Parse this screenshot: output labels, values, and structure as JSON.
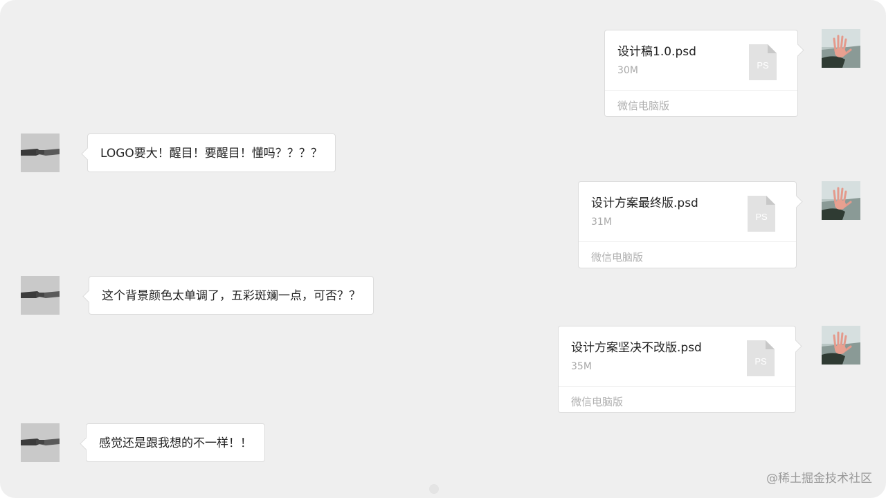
{
  "messages": [
    {
      "type": "file",
      "side": "right",
      "file_name": "设计稿1.0.psd",
      "file_size": "30M",
      "file_icon_label": "PS",
      "source": "微信电脑版"
    },
    {
      "type": "text",
      "side": "left",
      "text": "LOGO要大！醒目！要醒目！懂吗？？？？"
    },
    {
      "type": "file",
      "side": "right",
      "file_name": "设计方案最终版.psd",
      "file_size": "31M",
      "file_icon_label": "PS",
      "source": "微信电脑版"
    },
    {
      "type": "text",
      "side": "left",
      "text": "这个背景颜色太单调了，五彩斑斓一点，可否？？"
    },
    {
      "type": "file",
      "side": "right",
      "file_name": "设计方案坚决不改版.psd",
      "file_size": "35M",
      "file_icon_label": "PS",
      "source": "微信电脑版"
    },
    {
      "type": "text",
      "side": "left",
      "text": "感觉还是跟我想的不一样！！"
    }
  ],
  "watermark": "@稀土掘金技术社区",
  "colors": {
    "background": "#efefef",
    "bubble": "#ffffff",
    "bubble_border": "#dcdcdc",
    "file_icon": "#e2e2e2",
    "secondary_text": "#a8a8a8"
  },
  "icons": {
    "file_icon": "psd-file-icon",
    "left_avatar": "handshake-avatar",
    "right_avatar": "raised-hand-avatar"
  }
}
